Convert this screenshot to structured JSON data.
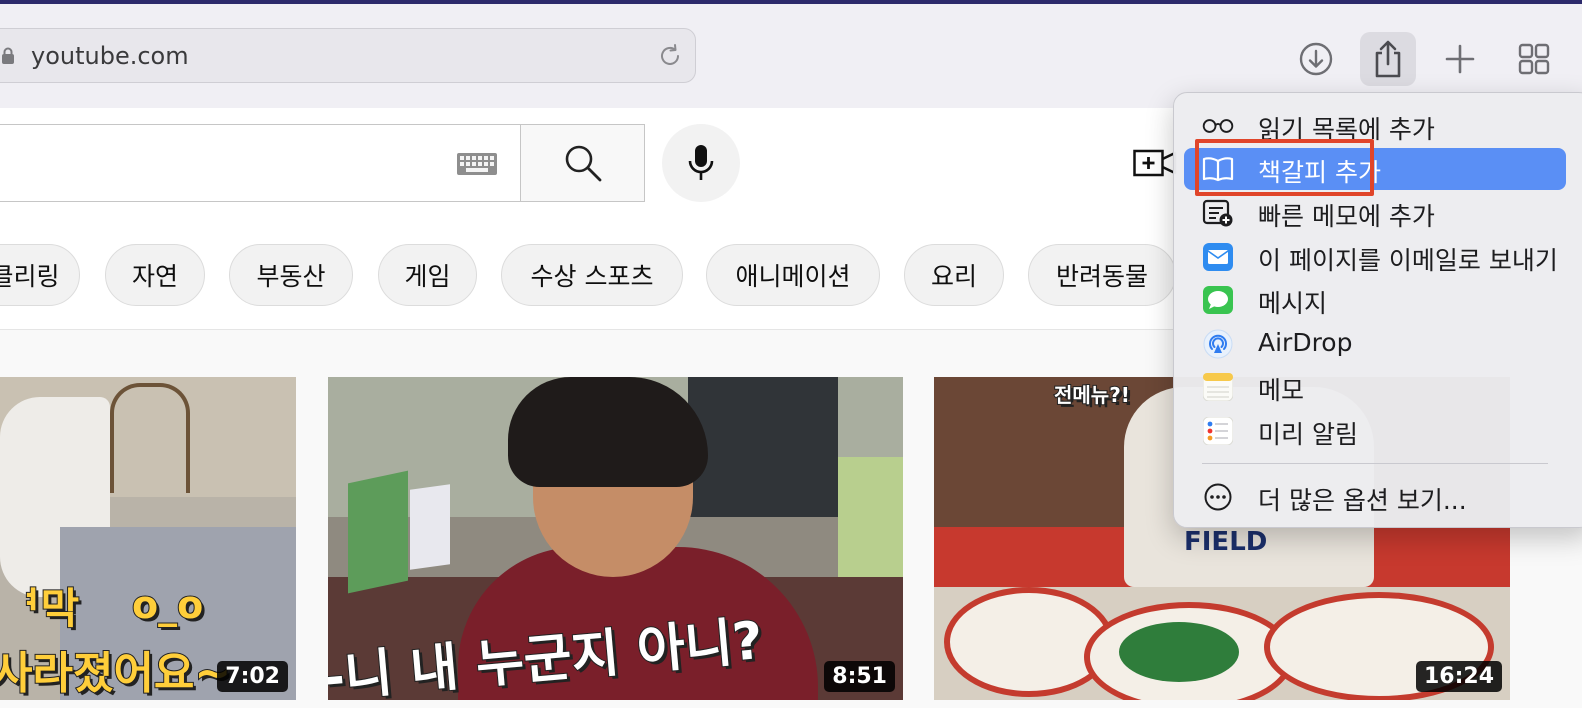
{
  "browser": {
    "url": "youtube.com",
    "toolbar_icons": [
      "lock-icon",
      "reload-icon",
      "download-icon",
      "share-icon",
      "plus-icon",
      "tabs-grid-icon"
    ]
  },
  "youtube": {
    "header_icons": [
      "keyboard-icon",
      "search-icon",
      "microphone-icon",
      "create-video-icon"
    ],
    "chips": [
      "클리링",
      "자연",
      "부동산",
      "게임",
      "수상 스포츠",
      "애니메이션",
      "요리",
      "반려동물"
    ],
    "videos": [
      {
        "duration": "7:02",
        "caption_1": "ᅧ막",
        "caption_2": "사라졌어요~",
        "caption_3": "o_o"
      },
      {
        "duration": "8:51",
        "caption_1": "-니 내 누군지 아니?"
      },
      {
        "duration": "16:24",
        "caption_1": "전메뉴?!",
        "caption_2": "FIELD"
      }
    ]
  },
  "share_menu": {
    "items": [
      {
        "label": "읽기 목록에 추가",
        "icon": "glasses-icon"
      },
      {
        "label": "책갈피 추가",
        "icon": "book-icon",
        "selected": true
      },
      {
        "label": "빠른 메모에 추가",
        "icon": "quick-note-icon"
      },
      {
        "label": "이 페이지를 이메일로 보내기",
        "icon": "mail-icon"
      },
      {
        "label": "메시지",
        "icon": "messages-icon"
      },
      {
        "label": "AirDrop",
        "icon": "airdrop-icon"
      },
      {
        "label": "메모",
        "icon": "notes-icon"
      },
      {
        "label": "미리 알림",
        "icon": "reminders-icon"
      },
      {
        "label": "더 많은 옵션 보기...",
        "icon": "more-icon"
      }
    ]
  },
  "colors": {
    "menu_highlight": "#5a8ff5",
    "annotation_box": "#e0452a",
    "duration_badge": "#000000"
  }
}
